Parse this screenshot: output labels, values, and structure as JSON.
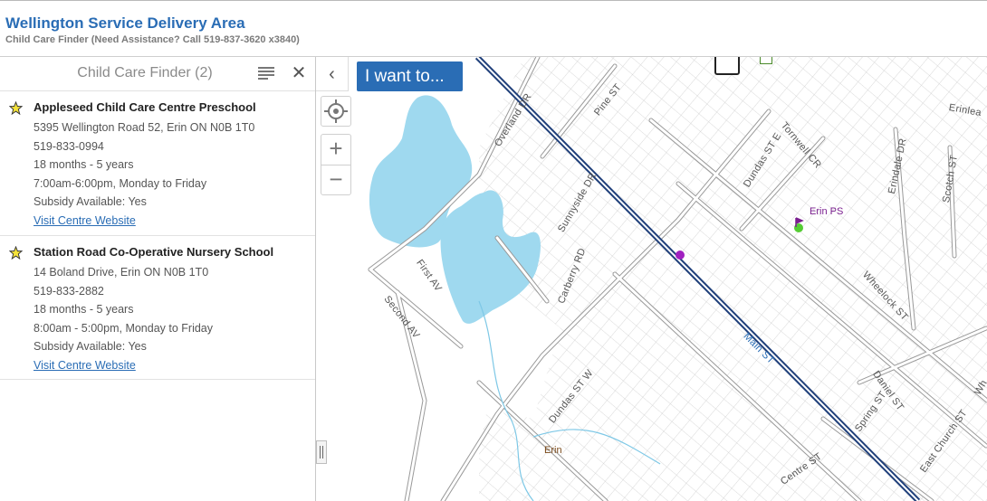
{
  "header": {
    "title": "Wellington Service Delivery Area",
    "subtitle": "Child Care Finder (Need Assistance? Call 519-837-3620 x3840)"
  },
  "panel": {
    "title": "Child Care Finder (2)",
    "results": [
      {
        "name": "Appleseed Child Care Centre Preschool",
        "address": "5395 Wellington Road 52, Erin ON N0B 1T0",
        "phone": "519-833-0994",
        "ages": "18 months - 5 years",
        "hours": "7:00am-6:00pm, Monday to Friday",
        "subsidy": "Subsidy Available: Yes",
        "link": "Visit Centre Website"
      },
      {
        "name": "Station Road Co-Operative Nursery School",
        "address": "14 Boland Drive, Erin ON N0B 1T0",
        "phone": "519-833-2882",
        "ages": "18 months - 5 years",
        "hours": "8:00am - 5:00pm, Monday to Friday",
        "subsidy": "Subsidy Available: Yes",
        "link": "Visit Centre Website"
      }
    ]
  },
  "map": {
    "iwant_label": "I want to...",
    "zoom_in": "+",
    "zoom_out": "−",
    "collapse": "‹",
    "streets": {
      "overland": "Overland DR",
      "pine": "Pine ST",
      "dundas_e": "Dundas ST E",
      "tornwell": "Tornwell CR",
      "erindale": "Erindale DR",
      "scotch": "Scotch ST",
      "erinlea": "Erinlea",
      "sunnyside": "Sunnyside DR",
      "carberry": "Carberry RD",
      "first": "First AV",
      "second": "Second AV",
      "wheelock": "Wheelock ST",
      "main": "Main ST",
      "dundas_w": "Dundas ST W",
      "daniel": "Daniel ST",
      "spring": "Spring ST",
      "east_church": "East Church ST",
      "centre": "Centre ST",
      "wh": "Wh"
    },
    "places": {
      "erin_ps": "Erin PS",
      "erin": "Erin"
    },
    "colors": {
      "water": "#9fd9ef",
      "main_road": "#1f3f7a",
      "accent": "#2a6db5",
      "poi": "#a020c0"
    }
  }
}
